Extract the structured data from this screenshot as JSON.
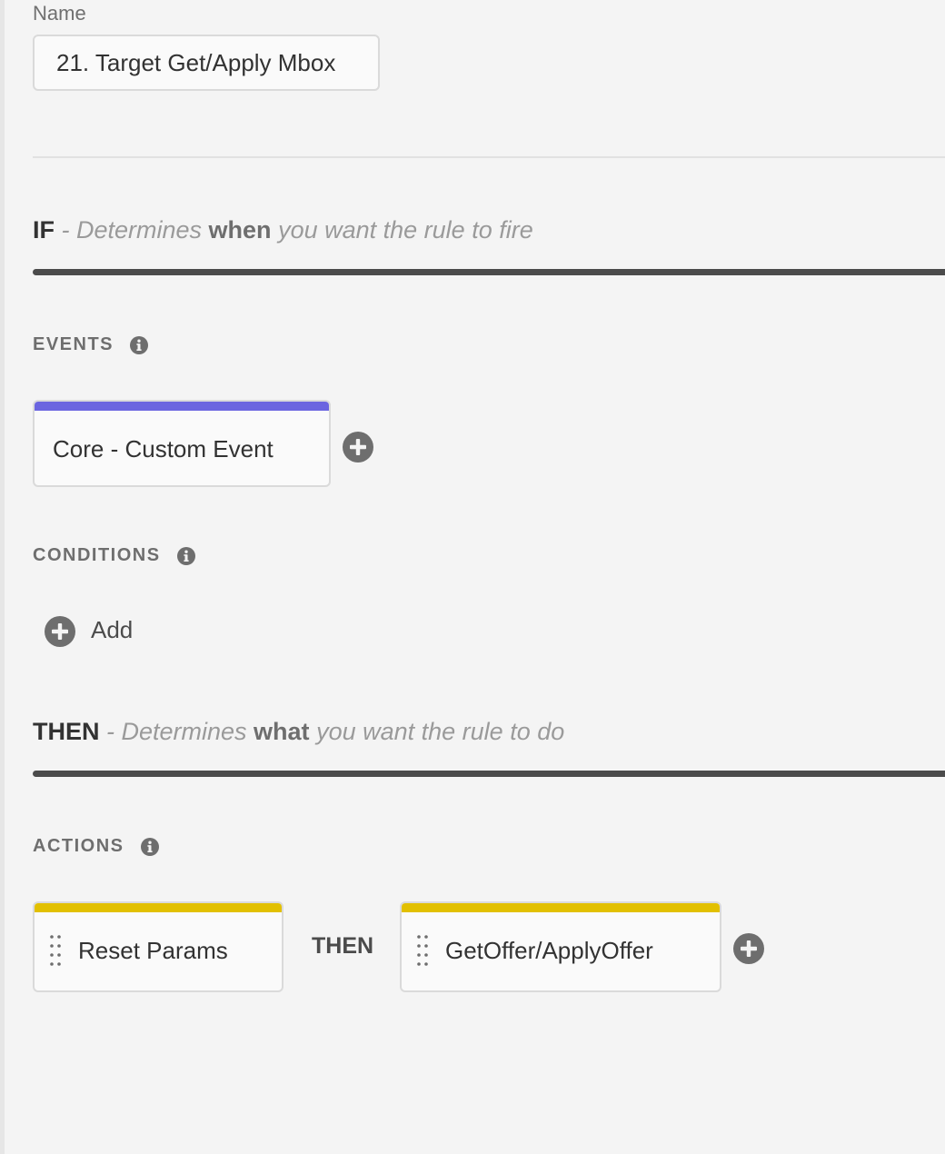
{
  "name_field": {
    "label": "Name",
    "value": "21. Target Get/Apply Mbox"
  },
  "if_section": {
    "keyword": "IF",
    "desc_prefix": " - Determines ",
    "desc_emphasis": "when",
    "desc_suffix": " you want the rule to fire"
  },
  "events": {
    "heading": "EVENTS",
    "info_icon": "info-icon",
    "items": [
      {
        "label": "Core - Custom Event",
        "stripe_color": "#6b65e0"
      }
    ],
    "add_icon": "plus-circle-icon"
  },
  "conditions": {
    "heading": "CONDITIONS",
    "info_icon": "info-icon",
    "add_label": "Add",
    "add_icon": "plus-circle-icon"
  },
  "then_section": {
    "keyword": "THEN",
    "desc_prefix": " - Determines ",
    "desc_emphasis": "what",
    "desc_suffix": " you want the rule to do"
  },
  "actions": {
    "heading": "ACTIONS",
    "info_icon": "info-icon",
    "items": [
      {
        "label": "Reset Params",
        "stripe_color": "#e2c000"
      },
      {
        "label": "GetOffer/ApplyOffer",
        "stripe_color": "#e2c000"
      }
    ],
    "connector": "THEN",
    "add_icon": "plus-circle-icon"
  },
  "colors": {
    "background": "#f4f4f4",
    "icon": "#6e6e6e",
    "text_dark": "#323232"
  }
}
